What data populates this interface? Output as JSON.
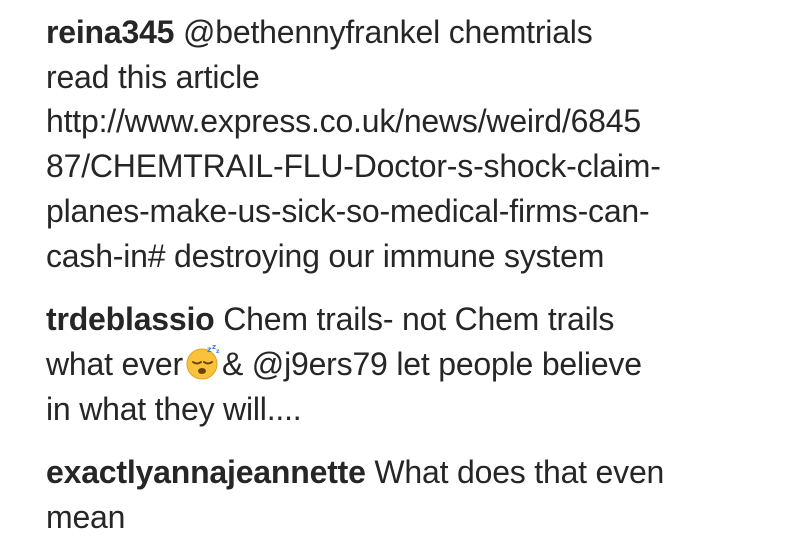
{
  "comments": [
    {
      "username": "reina345",
      "mention": "@bethennyfrankel",
      "lines": [
        "chemtrials",
        "read this article",
        "http://www.express.co.uk/news/weird/6845",
        "87/CHEMTRAIL-FLU-Doctor-s-shock-claim-",
        "planes-make-us-sick-so-medical-firms-can-",
        "cash-in# destroying our immune system"
      ]
    },
    {
      "username": "trdeblassio",
      "line1": "Chem trails- not Chem trails",
      "line2_before": "what ever",
      "emoji": "sleeping-face-emoji",
      "line2_after": "&",
      "mention": "@j9ers79",
      "line2_end": "let people believe",
      "line3": "in what they will...."
    },
    {
      "username": "exactlyannajeannette",
      "line1": "What does that even",
      "line2": "mean"
    }
  ]
}
